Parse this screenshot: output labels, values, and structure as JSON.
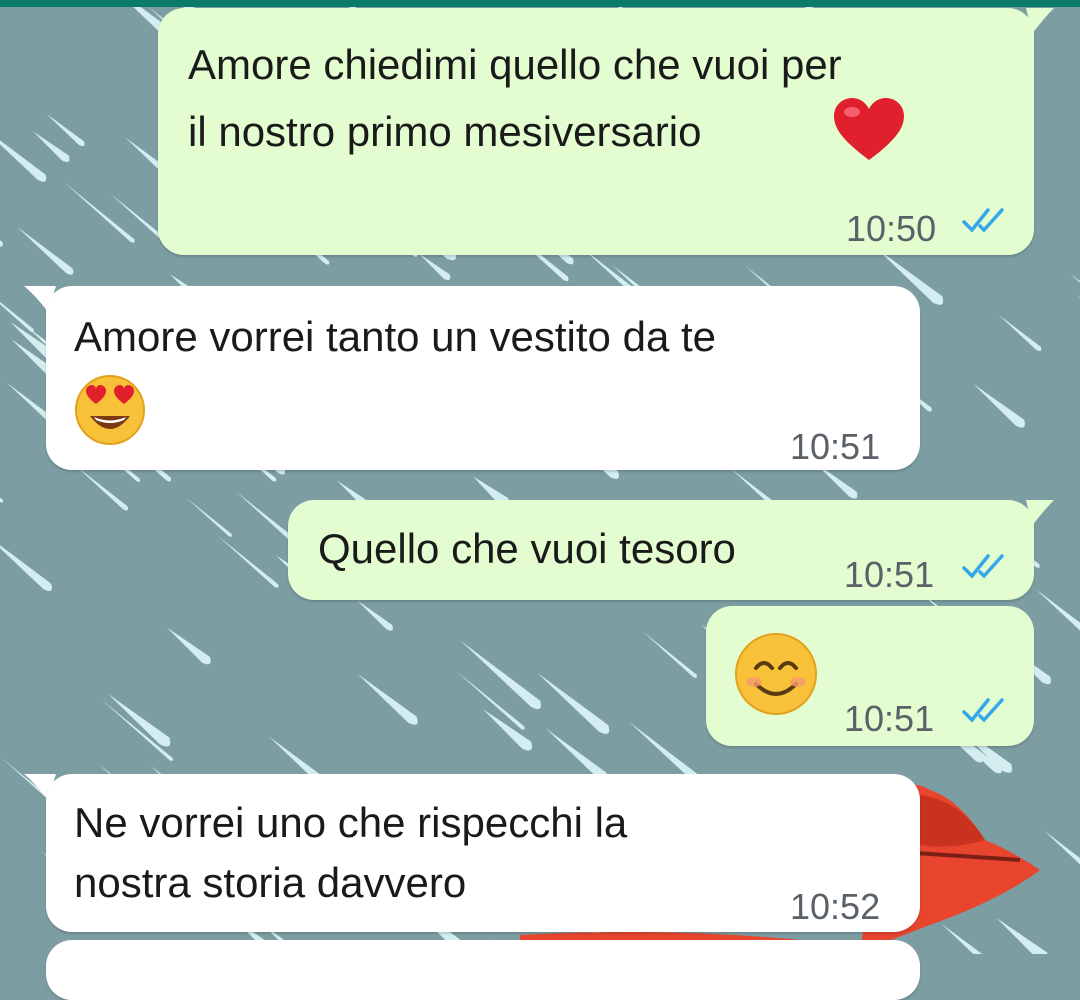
{
  "colors": {
    "header": "#0b7a67",
    "wallpaper": "#7c9ea3",
    "outgoing_bubble": "#e3fdd0",
    "incoming_bubble": "#ffffff",
    "read_ticks": "#34a7e8"
  },
  "messages": [
    {
      "direction": "out",
      "lines": [
        "Amore chiedimi quello che vuoi per",
        "il nostro primo mesiversario"
      ],
      "emoji": "heart-emoji",
      "time": "10:50",
      "status": "read"
    },
    {
      "direction": "in",
      "lines": [
        "Amore vorrei tanto un vestito da te"
      ],
      "emoji": "heart-eyes-emoji",
      "time": "10:51"
    },
    {
      "direction": "out",
      "lines": [
        "Quello che vuoi tesoro"
      ],
      "time": "10:51",
      "status": "read"
    },
    {
      "direction": "out",
      "lines": [],
      "emoji": "smiling-face-emoji",
      "time": "10:51",
      "status": "read"
    },
    {
      "direction": "in",
      "lines": [
        "Ne vorrei uno che rispecchi la",
        "nostra storia davvero"
      ],
      "time": "10:52"
    }
  ]
}
